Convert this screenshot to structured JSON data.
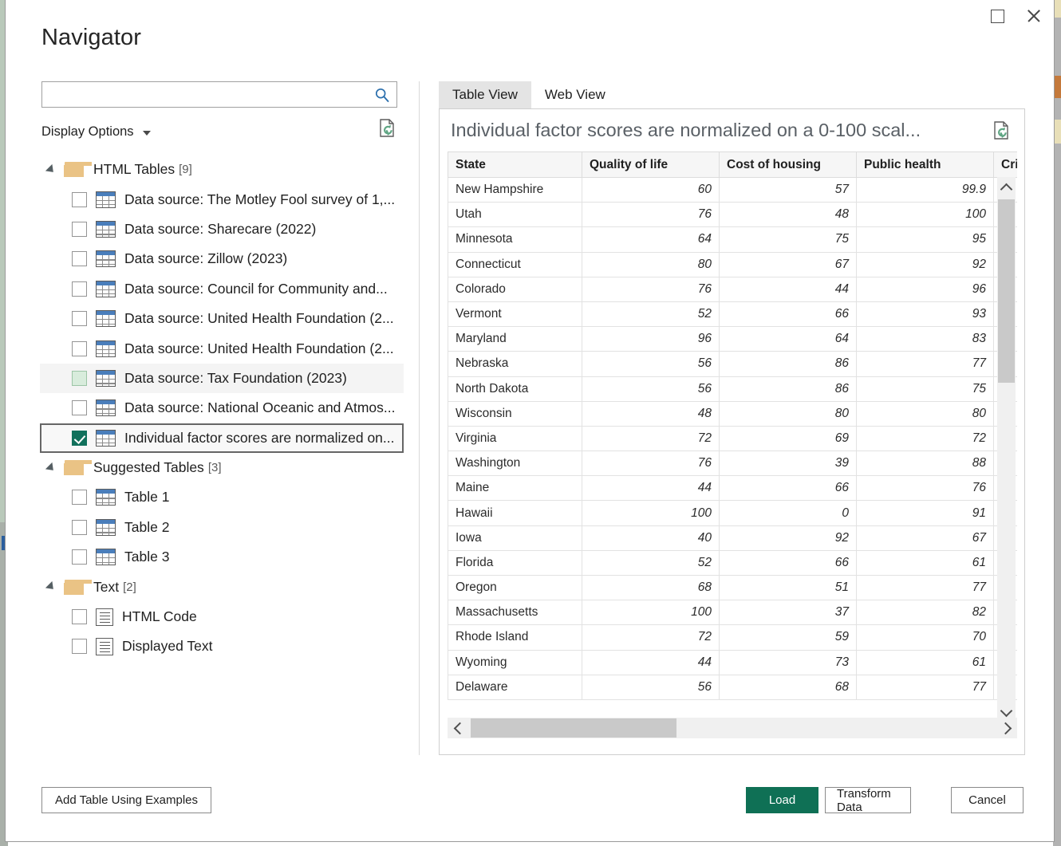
{
  "window": {
    "title": "Navigator",
    "restore_icon": "restore-window-icon",
    "close_icon": "close-icon"
  },
  "search": {
    "value": "",
    "placeholder": "",
    "icon": "search-icon"
  },
  "display_options": {
    "label": "Display Options",
    "caret_icon": "chevron-down-icon",
    "refresh_icon": "refresh-page-icon"
  },
  "tree": {
    "groups": [
      {
        "label": "HTML Tables",
        "count": "[9]",
        "icon": "folder-icon",
        "arrow_icon": "triangle-expanded-icon",
        "items": [
          {
            "label": "Data source: The Motley Fool survey of 1,...",
            "icon": "table-icon",
            "checked": false,
            "state": "normal"
          },
          {
            "label": "Data source: Sharecare (2022)",
            "icon": "table-icon",
            "checked": false,
            "state": "normal"
          },
          {
            "label": "Data source: Zillow (2023)",
            "icon": "table-icon",
            "checked": false,
            "state": "normal"
          },
          {
            "label": "Data source: Council for Community and...",
            "icon": "table-icon",
            "checked": false,
            "state": "normal"
          },
          {
            "label": "Data source: United Health Foundation (2...",
            "icon": "table-icon",
            "checked": false,
            "state": "normal"
          },
          {
            "label": "Data source: United Health Foundation (2...",
            "icon": "table-icon",
            "checked": false,
            "state": "normal"
          },
          {
            "label": "Data source: Tax Foundation (2023)",
            "icon": "table-icon",
            "checked": false,
            "state": "hovered"
          },
          {
            "label": "Data source: National Oceanic and Atmos...",
            "icon": "table-icon",
            "checked": false,
            "state": "normal"
          },
          {
            "label": "Individual factor scores are normalized on...",
            "icon": "table-icon",
            "checked": true,
            "state": "selected"
          }
        ]
      },
      {
        "label": "Suggested Tables",
        "count": "[3]",
        "icon": "folder-icon",
        "arrow_icon": "triangle-expanded-icon",
        "items": [
          {
            "label": "Table 1",
            "icon": "table-icon",
            "checked": false,
            "state": "normal"
          },
          {
            "label": "Table 2",
            "icon": "table-icon",
            "checked": false,
            "state": "normal"
          },
          {
            "label": "Table 3",
            "icon": "table-icon",
            "checked": false,
            "state": "normal"
          }
        ]
      },
      {
        "label": "Text",
        "count": "[2]",
        "icon": "folder-icon",
        "arrow_icon": "triangle-expanded-icon",
        "items": [
          {
            "label": "HTML Code",
            "icon": "text-document-icon",
            "checked": false,
            "state": "normal"
          },
          {
            "label": "Displayed Text",
            "icon": "text-document-icon",
            "checked": false,
            "state": "normal"
          }
        ]
      }
    ]
  },
  "preview": {
    "tabs": [
      {
        "label": "Table View",
        "active": true
      },
      {
        "label": "Web View",
        "active": false
      }
    ],
    "title": "Individual factor scores are normalized on a 0-100 scal...",
    "refresh_icon": "refresh-page-icon",
    "scroll": {
      "vertical_up_icon": "chevron-up-icon",
      "vertical_down_icon": "chevron-down-icon",
      "horizontal_left_icon": "chevron-left-icon",
      "horizontal_right_icon": "chevron-right-icon"
    }
  },
  "chart_data": {
    "type": "table",
    "title": "Individual factor scores are normalized on a 0-100 scal...",
    "columns": [
      "State",
      "Quality of life",
      "Cost of housing",
      "Public health",
      "Crime"
    ],
    "rows": [
      [
        "New Hampshire",
        "60",
        "57",
        "99.9",
        ""
      ],
      [
        "Utah",
        "76",
        "48",
        "100",
        ""
      ],
      [
        "Minnesota",
        "64",
        "75",
        "95",
        ""
      ],
      [
        "Connecticut",
        "80",
        "67",
        "92",
        ""
      ],
      [
        "Colorado",
        "76",
        "44",
        "96",
        ""
      ],
      [
        "Vermont",
        "52",
        "66",
        "93",
        ""
      ],
      [
        "Maryland",
        "96",
        "64",
        "83",
        ""
      ],
      [
        "Nebraska",
        "56",
        "86",
        "77",
        ""
      ],
      [
        "North Dakota",
        "56",
        "86",
        "75",
        ""
      ],
      [
        "Wisconsin",
        "48",
        "80",
        "80",
        ""
      ],
      [
        "Virginia",
        "72",
        "69",
        "72",
        ""
      ],
      [
        "Washington",
        "76",
        "39",
        "88",
        ""
      ],
      [
        "Maine",
        "44",
        "66",
        "76",
        ""
      ],
      [
        "Hawaii",
        "100",
        "0",
        "91",
        ""
      ],
      [
        "Iowa",
        "40",
        "92",
        "67",
        ""
      ],
      [
        "Florida",
        "52",
        "66",
        "61",
        ""
      ],
      [
        "Oregon",
        "68",
        "51",
        "77",
        ""
      ],
      [
        "Massachusetts",
        "100",
        "37",
        "82",
        ""
      ],
      [
        "Rhode Island",
        "72",
        "59",
        "70",
        ""
      ],
      [
        "Wyoming",
        "44",
        "73",
        "61",
        ""
      ],
      [
        "Delaware",
        "56",
        "68",
        "77",
        ""
      ]
    ]
  },
  "footer": {
    "add_table_label": "Add Table Using Examples",
    "load_label": "Load",
    "transform_label": "Transform Data",
    "cancel_label": "Cancel"
  },
  "colors": {
    "accent_green": "#0f7055",
    "checkbox_green": "#11715c",
    "folder_tan": "#eac385",
    "table_icon_blue": "#4a7ebb",
    "refresh_green": "#5fa583"
  }
}
